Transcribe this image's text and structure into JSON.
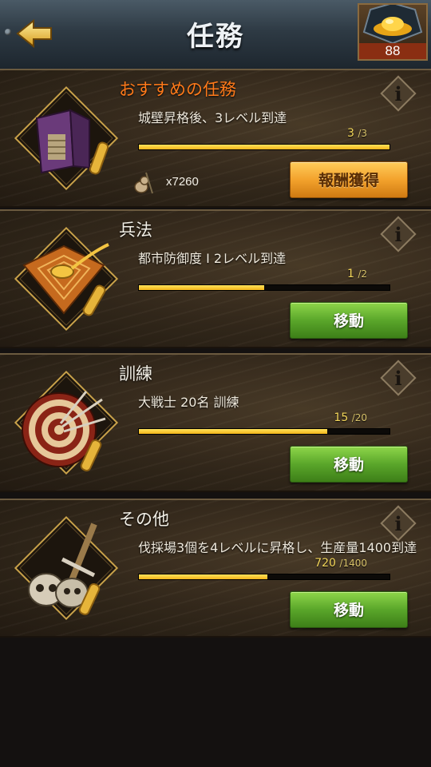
{
  "header": {
    "title": "任務",
    "gold_count": "88"
  },
  "quests": [
    {
      "title": "おすすめの任務",
      "description": "城壁昇格後、3レベル到達",
      "progress_current": "3",
      "progress_max": "/3",
      "progress_fraction": 1.0,
      "reward_qty": "x7260",
      "button_label": "報酬獲得",
      "icon": "wall-tower-icon"
    },
    {
      "title": "兵法",
      "description": "都市防御度 I 2レベル到達",
      "progress_current": "1",
      "progress_max": "/2",
      "progress_fraction": 0.5,
      "button_label": "移動",
      "icon": "compass-board-icon"
    },
    {
      "title": "訓練",
      "description": "大戦士 20名 訓練",
      "progress_current": "15",
      "progress_max": "/20",
      "progress_fraction": 0.75,
      "button_label": "移動",
      "icon": "target-arrows-icon"
    },
    {
      "title": "その他",
      "description": "伐採場3個を4レベルに昇格し、生産量1400到達",
      "progress_current": "720",
      "progress_max": "/1400",
      "progress_fraction": 0.514,
      "button_label": "移動",
      "icon": "skulls-icon"
    }
  ]
}
